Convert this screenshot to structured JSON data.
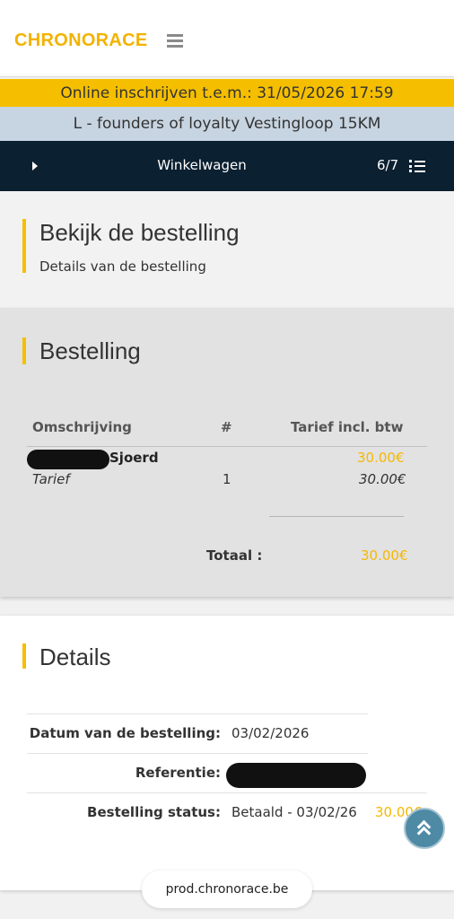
{
  "header": {
    "logo": "CHRONORACE",
    "menu_icon": "hamburger-menu-icon"
  },
  "registration_banner": "Online inschrijven t.e.m.: 31/05/2026 17:59",
  "event_banner": "L - founders of loyalty Vestingloop 15KM",
  "stepbar": {
    "title": "Winkelwagen",
    "step": "6/7",
    "back_icon": "caret-right-icon",
    "list_icon": "list-icon"
  },
  "section": {
    "title": "Bekijk de bestelling",
    "subtitle": "Details van de bestelling"
  },
  "order": {
    "title": "Bestelling",
    "columns": [
      "Omschrijving",
      "#",
      "Tarief incl. btw"
    ],
    "item": {
      "name": "Sjoerd",
      "price": "30.00€",
      "rate_label": "Tarief",
      "quantity": "1",
      "rate_price": "30.00€"
    },
    "total_label": "Totaal :",
    "total_value": "30.00€"
  },
  "details": {
    "title": "Details",
    "order_date_label": "Datum van de bestelling:",
    "order_date": "03/02/2026",
    "reference_label": "Referentie:",
    "status_label": "Bestelling status:",
    "status": "Betaald - 03/02/26",
    "status_amount": "30.00€"
  },
  "url": "prod.chronorace.be",
  "colors": {
    "accent": "#f5bf00",
    "stepbar": "#0b2030",
    "event_banner": "#c7d4e1",
    "scroll_button": "#4f8aa5"
  }
}
